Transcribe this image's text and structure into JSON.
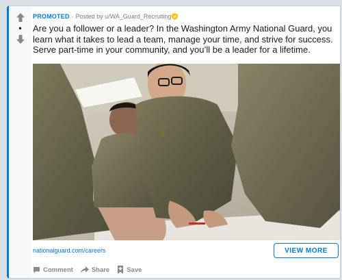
{
  "post": {
    "promoted_label": "PROMOTED",
    "separator": "·",
    "posted_by": "Posted by u/WA_Guard_Recruiting",
    "vote_count": "•",
    "title": "Are you a follower or a leader? In the Washington Army National Guard, you learn what it takes to lead a team, manage your time, and strive for success. Serve part-time in your community, and you’ll be a leader for a lifetime.",
    "link_url": "nationalguard.com/careers",
    "cta_label": "VIEW MORE"
  },
  "actions": {
    "comment": "Comment",
    "share": "Share",
    "save": "Save"
  },
  "colors": {
    "accent": "#0079d3",
    "muted": "#878a8c",
    "page_bg": "#dae0e6"
  },
  "icons": [
    "upvote-icon",
    "downvote-icon",
    "moderator-badge-icon",
    "comment-icon",
    "share-icon",
    "save-icon"
  ]
}
